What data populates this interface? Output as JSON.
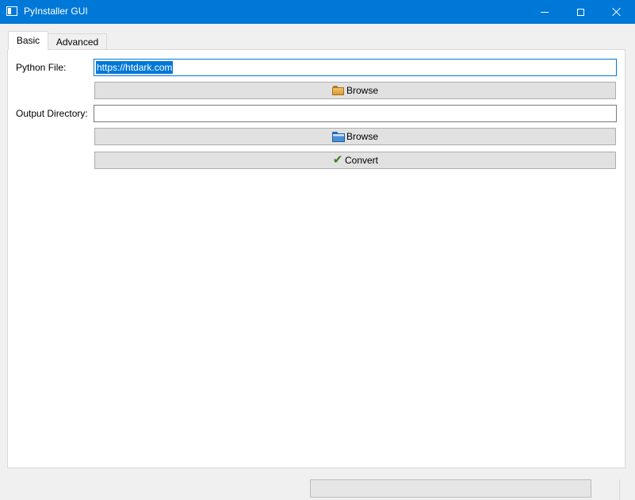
{
  "window": {
    "title": "PyInstaller GUI",
    "accent_color": "#0078d7"
  },
  "tabs": [
    {
      "label": "Basic",
      "active": true
    },
    {
      "label": "Advanced",
      "active": false
    }
  ],
  "form": {
    "python_file_label": "Python File:",
    "python_file_value": "https://htdark.com",
    "browse1_label": "Browse",
    "output_dir_label": "Output Directory:",
    "output_dir_value": "",
    "browse2_label": "Browse",
    "convert_label": "Convert"
  },
  "icons": {
    "browse1": "folder-open-icon",
    "browse2": "folder-blue-icon",
    "convert": "check-icon"
  },
  "progress": {
    "value_percent": 0
  }
}
